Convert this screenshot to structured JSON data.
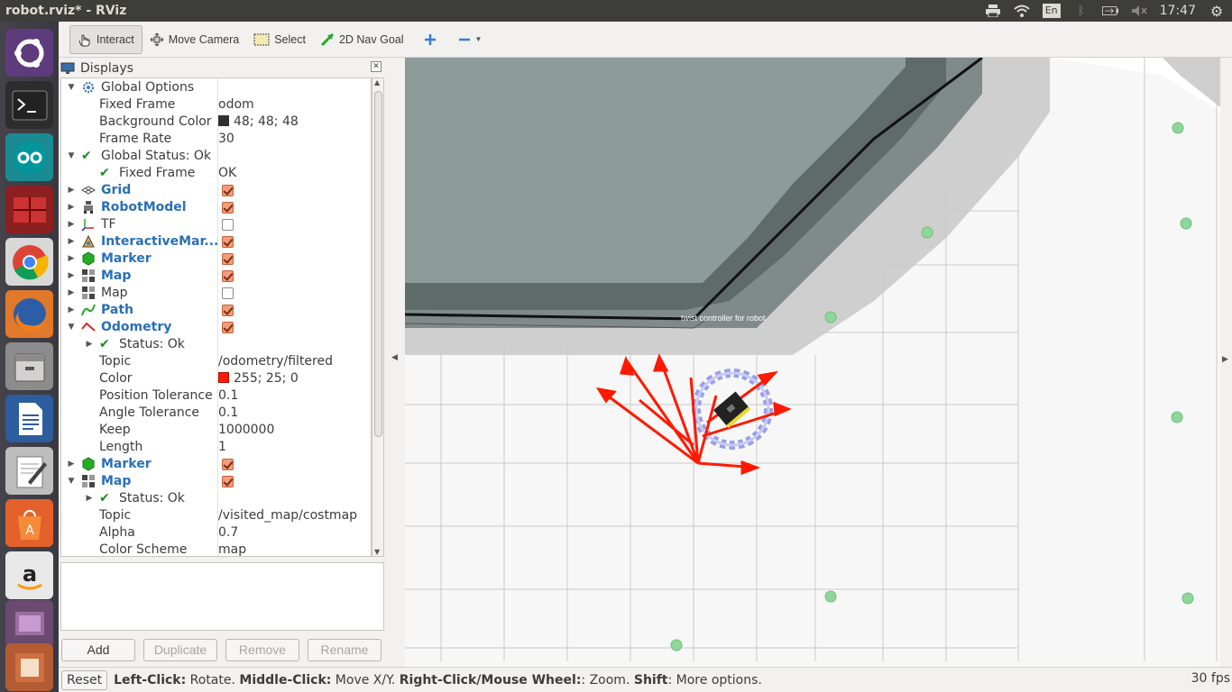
{
  "window": {
    "title": "robot.rviz* - RViz"
  },
  "tray": {
    "keyboard": "En",
    "clock": "17:47"
  },
  "toolbar": {
    "interact": "Interact",
    "move_camera": "Move Camera",
    "select": "Select",
    "nav_goal": "2D Nav Goal"
  },
  "displays": {
    "title": "Displays",
    "rows": {
      "global_options": "Global Options",
      "fixed_frame_label": "Fixed Frame",
      "fixed_frame_value": "odom",
      "bg_color_label": "Background Color",
      "bg_color_value": "48; 48; 48",
      "frame_rate_label": "Frame Rate",
      "frame_rate_value": "30",
      "global_status": "Global Status: Ok",
      "fixed_frame_status_label": "Fixed Frame",
      "fixed_frame_status_value": "OK",
      "grid": "Grid",
      "robot_model": "RobotModel",
      "tf": "TF",
      "interactive_markers": "InteractiveMar...",
      "marker1": "Marker",
      "map1": "Map",
      "map2": "Map",
      "path": "Path",
      "odometry": "Odometry",
      "odom_status": "Status: Ok",
      "odom_topic_label": "Topic",
      "odom_topic_value": "/odometry/filtered",
      "odom_color_label": "Color",
      "odom_color_value": "255; 25; 0",
      "pos_tol_label": "Position Tolerance",
      "pos_tol_value": "0.1",
      "ang_tol_label": "Angle Tolerance",
      "ang_tol_value": "0.1",
      "keep_label": "Keep",
      "keep_value": "1000000",
      "length_label": "Length",
      "length_value": "1",
      "marker2": "Marker",
      "map3": "Map",
      "map3_status": "Status: Ok",
      "map3_topic_label": "Topic",
      "map3_topic_value": "/visited_map/costmap",
      "alpha_label": "Alpha",
      "alpha_value": "0.7",
      "scheme_label": "Color Scheme",
      "scheme_value": "map"
    },
    "checked": {
      "grid": true,
      "robot_model": true,
      "tf": false,
      "interactive_markers": true,
      "marker1": true,
      "map1": true,
      "map2": false,
      "path": true,
      "odometry": true,
      "marker2": true,
      "map3": true
    },
    "colors": {
      "background": "#303030",
      "odometry": "#ff1900"
    }
  },
  "buttons": {
    "add": "Add",
    "duplicate": "Duplicate",
    "remove": "Remove",
    "rename": "Rename"
  },
  "viewport": {
    "robot_label": "twist controller for robot"
  },
  "status": {
    "reset": "Reset",
    "help_lc": "Left-Click:",
    "help_lc_text": " Rotate. ",
    "help_mc": "Middle-Click:",
    "help_mc_text": " Move X/Y. ",
    "help_rc": "Right-Click/Mouse Wheel:",
    "help_rc_text": ": Zoom. ",
    "help_shift": "Shift",
    "help_shift_text": ": More options.",
    "fps": "30 fps"
  }
}
